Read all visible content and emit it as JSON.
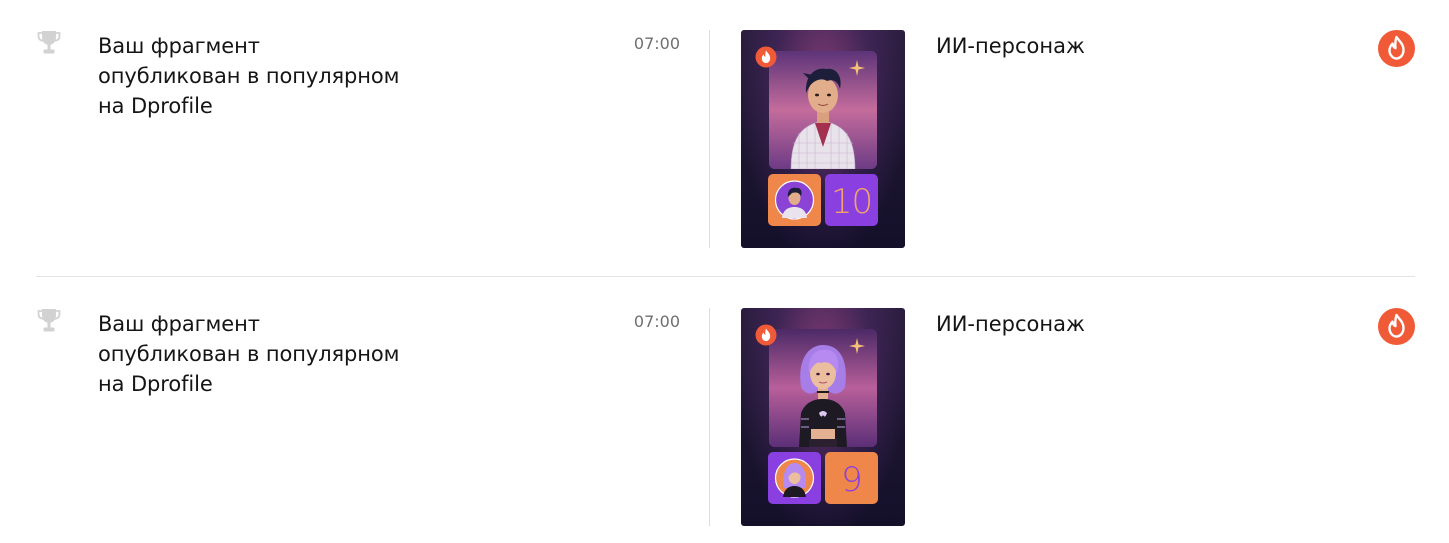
{
  "notifications": [
    {
      "message_lines": [
        "Ваш фрагмент",
        "опубликован в популярном",
        "на Dprofile"
      ],
      "time": "07:00",
      "title": "ИИ-персонаж",
      "card_number": "10",
      "icon": "trophy-icon",
      "badge_icon": "fire-icon"
    },
    {
      "message_lines": [
        "Ваш фрагмент",
        "опубликован в популярном",
        "на Dprofile"
      ],
      "time": "07:00",
      "title": "ИИ-персонаж",
      "card_number": "9",
      "icon": "trophy-icon",
      "badge_icon": "fire-icon"
    }
  ],
  "colors": {
    "accent_fire": "#f15a37",
    "muted_icon": "#cfcfcf",
    "divider": "#e3e3e3",
    "tile_orange": "#f0874a",
    "tile_purple": "#8a3fe0"
  }
}
